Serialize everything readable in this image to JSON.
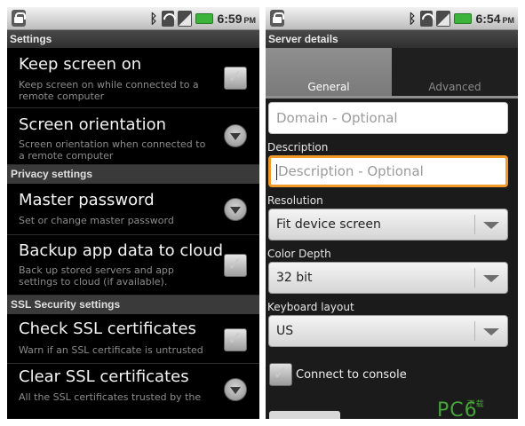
{
  "left_screen": {
    "status_time": "6:59",
    "status_ampm": "PM",
    "title": "Settings",
    "rows": [
      {
        "title": "Keep screen on",
        "subtitle": "Keep screen on while connected to a remote computer",
        "widget": "checkbox-icon"
      },
      {
        "title": "Screen orientation",
        "subtitle": "Screen orientation when connected to a remote computer",
        "widget": "dropdown-circle-icon"
      }
    ],
    "privacy_header": "Privacy settings",
    "privacy_rows": [
      {
        "title": "Master password",
        "subtitle": "Set or change master password",
        "widget": "dropdown-circle-icon"
      },
      {
        "title": "Backup app data to cloud",
        "subtitle": "Back up stored servers and app settings to cloud (if available).",
        "widget": "checkbox-icon"
      }
    ],
    "ssl_header": "SSL Security settings",
    "ssl_rows": [
      {
        "title": "Check SSL certificates",
        "subtitle": "Warn if an SSL certificate is untrusted",
        "widget": "checkbox-icon"
      },
      {
        "title": "Clear SSL certificates",
        "subtitle": "All the SSL certificates trusted by the",
        "widget": "dropdown-circle-icon"
      }
    ]
  },
  "right_screen": {
    "status_time": "6:54",
    "status_ampm": "PM",
    "title": "Server details",
    "tabs": [
      {
        "label": "General",
        "selected": true
      },
      {
        "label": "Advanced",
        "selected": false
      }
    ],
    "domain_placeholder": "Domain - Optional",
    "description_label": "Description",
    "description_placeholder": "Description - Optional",
    "resolution_label": "Resolution",
    "resolution_value": "Fit device screen",
    "color_depth_label": "Color Depth",
    "color_depth_value": "32 bit",
    "keyboard_label": "Keyboard layout",
    "keyboard_value": "US",
    "connect_console_label": "Connect to console"
  },
  "watermark": {
    "text": "PC6",
    "sub": "下载"
  },
  "colors": {
    "focus_border": "#f09a2a",
    "battery": "#3cb43c"
  }
}
